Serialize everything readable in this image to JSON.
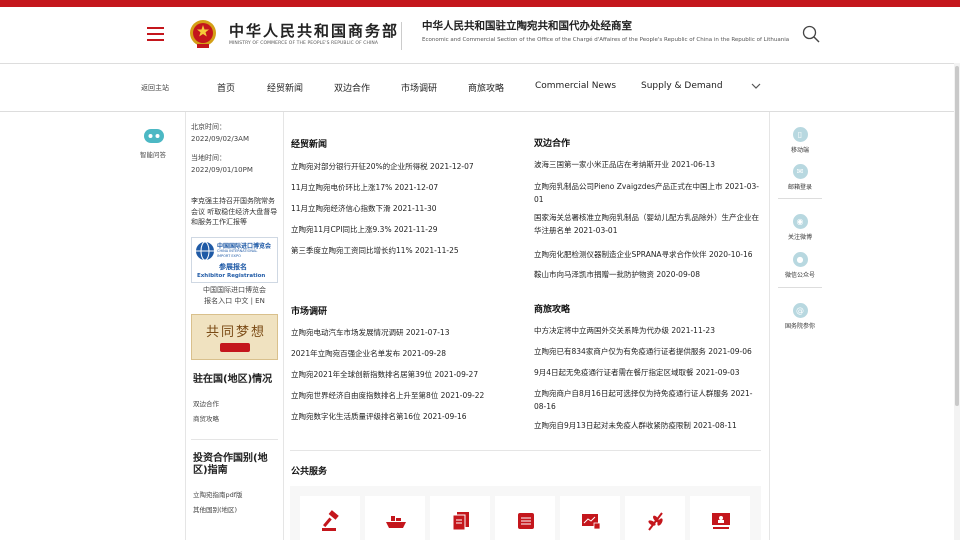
{
  "header": {
    "ministry_cn": "中华人民共和国商务部",
    "ministry_en": "MINISTRY OF COMMERCE OF THE PEOPLE'S REPUBLIC OF CHINA",
    "office_cn": "中华人民共和国驻立陶宛共和国代办处经商室",
    "office_en": "Economic and Commercial Section of the Office of the Chargé d'Affaires of the People's Republic of China in the Republic of Lithuania"
  },
  "nav": {
    "home": "返回主站",
    "items": [
      "首页",
      "经贸新闻",
      "双边合作",
      "市场调研",
      "商旅攻略",
      "Commercial News",
      "Supply & Demand"
    ]
  },
  "left": {
    "robot_label": "智能问答",
    "beijing_time_label": "北京时间：",
    "beijing_time": "2022/09/02/3AM",
    "local_time_label": "当地时间：",
    "local_time": "2022/09/01/10PM",
    "headline": "李克强主持召开国务院常务会议 听取稳住经济大盘督导和服务工作汇报等",
    "expo_cn": "中国国际进口博览会",
    "expo_en1": "CHINA INTERNATIONAL",
    "expo_en2": "IMPORT EXPO",
    "expo_reg_cn": "参展报名",
    "expo_reg_en": "Exhibitor Registration",
    "expo_label1": "中国国际进口博览会",
    "expo_label2": "报名入口 中文 | EN",
    "dream_text": "共同梦想",
    "section1_title": "驻在国(地区)情况",
    "section1_links": [
      "双边合作",
      "商贸攻略"
    ],
    "section2_title": "投资合作国别(地区)指南",
    "section2_links": [
      "立陶宛指南pdf版",
      "其他国别(地区)"
    ]
  },
  "main": {
    "news": {
      "title": "经贸新闻",
      "items": [
        "立陶宛对部分银行开征20%的企业所得税 2021-12-07",
        "11月立陶宛电价环比上涨17% 2021-12-07",
        "11月立陶宛经济信心指数下滑 2021-11-30",
        "立陶宛11月CPI同比上涨9.3% 2021-11-29",
        "第三季度立陶宛工资同比增长约11% 2021-11-25"
      ]
    },
    "bilateral": {
      "title": "双边合作",
      "items": [
        "波海三国第一家小米正品店在考纳斯开业 2021-06-13",
        "立陶宛乳制品公司Pieno Zvaigzdes产品正式在中国上市 2021-03-01",
        "国家海关总署核准立陶宛乳制品（婴幼儿配方乳品除外）生产企业在华注册名单 2021-03-01",
        "立陶宛化肥检测仪器制造企业SPRANA寻求合作伙伴 2020-10-16",
        "鞍山市向马泽凯市捐赠一批防护物资 2020-09-08"
      ]
    },
    "research": {
      "title": "市场调研",
      "items": [
        "立陶宛电动汽车市场发展情况调研 2021-07-13",
        "2021年立陶宛百强企业名单发布 2021-09-28",
        "立陶宛2021年全球创新指数排名居第39位 2021-09-27",
        "立陶宛世界经济自由度指数排名上升至第8位 2021-09-22",
        "立陶宛数字化生活质量评级排名第16位 2021-09-16"
      ]
    },
    "travel": {
      "title": "商旅攻略",
      "items": [
        "中方决定将中立两国外交关系降为代办级 2021-11-23",
        "立陶宛已有834家商户仅为有免疫通行证者提供服务 2021-09-06",
        "9月4日起无免疫通行证者需在餐厅指定区域取餐 2021-09-03",
        "立陶宛商户自8月16日起可选择仅为持免疫通行证人群服务 2021-08-16",
        "立陶宛自9月13日起对未免疫人群收紧防疫限制 2021-08-11"
      ]
    },
    "public_service_title": "公共服务",
    "services": [
      "gavel-icon",
      "ship-icon",
      "documents-icon",
      "list-icon",
      "chart-lock-icon",
      "wheat-icon",
      "presentation-icon"
    ]
  },
  "right": {
    "items": [
      "移动端",
      "邮箱登录",
      "关注微博",
      "微信公众号",
      "国务院参你"
    ]
  },
  "colors": {
    "brand_red": "#c4161c",
    "rail_icon": "#b8d8e0"
  }
}
